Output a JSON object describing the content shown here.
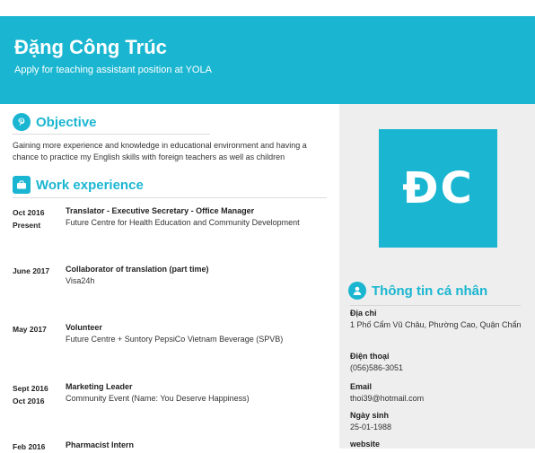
{
  "header": {
    "name": "Đặng Công Trúc",
    "tagline": "Apply for teaching assistant position at YOLA"
  },
  "objective": {
    "heading": "Objective",
    "text": "Gaining more experience and knowledge in educational environment and having a chance to practice my English skills with foreign teachers as well as children"
  },
  "work": {
    "heading": "Work experience",
    "jobs": [
      {
        "date1": "Oct 2016",
        "date2": "Present",
        "title": "Translator - Executive Secretary - Office Manager",
        "org": "Future Centre for Health Education and Community Development"
      },
      {
        "date1": "June 2017",
        "date2": "",
        "title": "Collaborator of translation (part time)",
        "org": "Visa24h"
      },
      {
        "date1": "May 2017",
        "date2": "",
        "title": "Volunteer",
        "org": "Future Centre + Suntory PepsiCo Vietnam Beverage (SPVB)"
      },
      {
        "date1": "Sept 2016",
        "date2": "Oct 2016",
        "title": "Marketing Leader",
        "org": "Community Event (Name: You Deserve Happiness)"
      },
      {
        "date1": "Feb 2016",
        "date2": "",
        "title": "Pharmacist Intern",
        "org": ""
      }
    ]
  },
  "sidebar": {
    "avatar_initials": "ĐC",
    "personal_heading": "Thông tin cá nhân",
    "address_label": "Địa chỉ",
    "address_value": "1 Phố Cẩm Vũ Châu, Phường Cao, Quận Chẩn",
    "phone_label": "Điện thoại",
    "phone_value": "(056)586-3051",
    "email_label": "Email",
    "email_value": "thoi39@hotmail.com",
    "dob_label": "Ngày sinh",
    "dob_value": "25-01-1988",
    "website_label": "website"
  },
  "colors": {
    "accent": "#1ab6d1",
    "sidebar_bg": "#eeeeee"
  },
  "icons": [
    "pinterest-icon",
    "briefcase-icon",
    "user-icon"
  ]
}
